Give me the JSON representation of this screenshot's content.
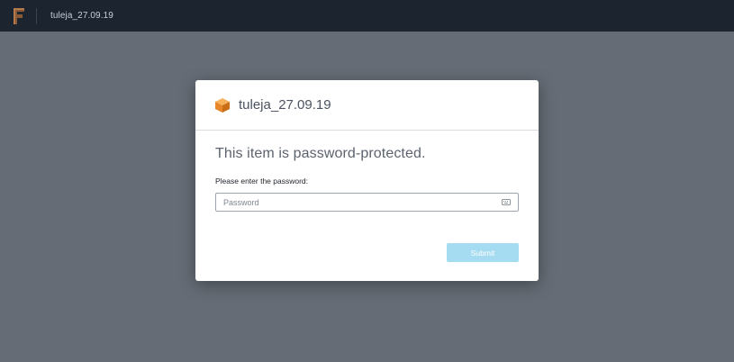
{
  "topbar": {
    "logo_icon": "fusion-f-logo-icon",
    "title": "tuleja_27.09.19"
  },
  "modal": {
    "header_icon": "box-icon",
    "title": "tuleja_27.09.19",
    "heading": "This item is password-protected.",
    "field_label": "Please enter the password:",
    "password_placeholder": "Password",
    "password_value": "",
    "key_icon": "password-keyboard-icon",
    "submit_label": "Submit"
  },
  "colors": {
    "topbar_bg": "#1c2430",
    "page_bg": "#656c75",
    "box_icon_orange": "#f0922d",
    "submit_bg_disabled": "#a6dcf1"
  }
}
